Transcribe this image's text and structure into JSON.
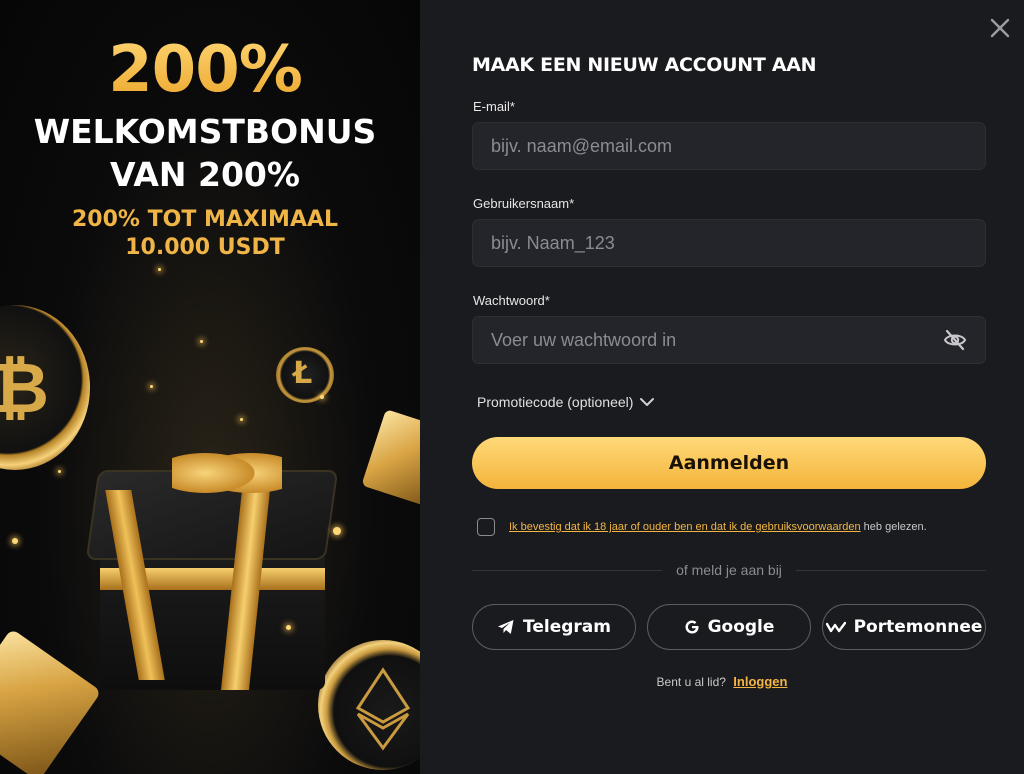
{
  "promo": {
    "percent": "200%",
    "title_line1": "WELKOMSTBONUS",
    "title_line2": "VAN 200%",
    "sub_line1": "200% TOT MAXIMAAL",
    "sub_line2": "10.000 USDT"
  },
  "form": {
    "title": "MAAK EEN NIEUW ACCOUNT AAN",
    "email": {
      "label": "E-mail*",
      "placeholder": "bijv. naam@email.com",
      "value": ""
    },
    "username": {
      "label": "Gebruikersnaam*",
      "placeholder": "bijv. Naam_123",
      "value": ""
    },
    "password": {
      "label": "Wachtwoord*",
      "placeholder": "Voer uw wachtwoord in",
      "value": ""
    },
    "promo_code_label": "Promotiecode (optioneel)",
    "submit_label": "Aanmelden",
    "terms": {
      "link_text": "Ik bevestig dat ik 18 jaar of ouder ben en dat ik de gebruiksvoorwaarden",
      "suffix": "heb gelezen.",
      "checked": false
    },
    "divider_text": "of meld je aan bij",
    "social": [
      {
        "label": "Telegram",
        "icon": "telegram-icon"
      },
      {
        "label": "Google",
        "icon": "google-icon"
      },
      {
        "label": "Portemonnee",
        "icon": "wallet-icon"
      }
    ],
    "login_prompt": "Bent u al lid?",
    "login_link": "Inloggen"
  },
  "colors": {
    "accent_gold": "#f3b43a",
    "panel_bg": "#1a1b1f",
    "field_bg": "#24252a"
  }
}
